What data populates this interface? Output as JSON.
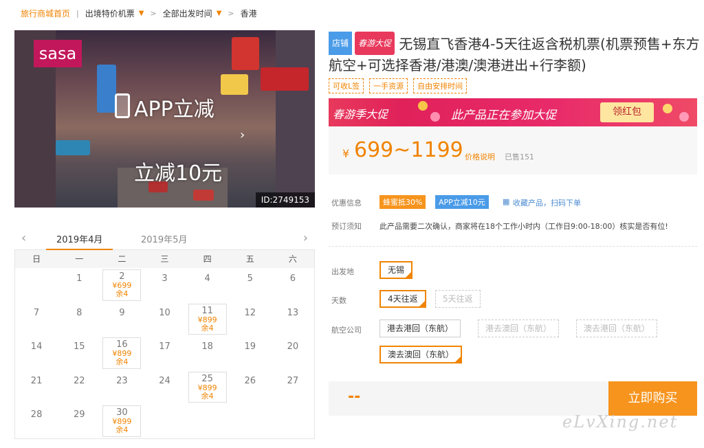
{
  "breadcrumb": {
    "home": "旅行商城首页",
    "level2": "出境特价机票",
    "level3": "全部出发时间",
    "current": "香港"
  },
  "hero": {
    "brand_sign": "sasa",
    "promo_line1": "APP立减",
    "promo_line2": "立减10元",
    "id_label": "ID:2749153",
    "slides": 4,
    "active_slide": 3
  },
  "calendar": {
    "tabs": [
      {
        "label": "2019年4月",
        "active": true
      },
      {
        "label": "2019年5月",
        "active": false
      }
    ],
    "weekdays": [
      "日",
      "一",
      "二",
      "三",
      "四",
      "五",
      "六"
    ],
    "days": [
      {
        "n": ""
      },
      {
        "n": "1"
      },
      {
        "n": "2",
        "price": "¥699",
        "left": "余4"
      },
      {
        "n": "3"
      },
      {
        "n": "4"
      },
      {
        "n": "5"
      },
      {
        "n": "6"
      },
      {
        "n": "7"
      },
      {
        "n": "8"
      },
      {
        "n": "9"
      },
      {
        "n": "10"
      },
      {
        "n": "11",
        "price": "¥899",
        "left": "余4"
      },
      {
        "n": "12"
      },
      {
        "n": "13"
      },
      {
        "n": "14"
      },
      {
        "n": "15"
      },
      {
        "n": "16",
        "price": "¥899",
        "left": "余4"
      },
      {
        "n": "17"
      },
      {
        "n": "18"
      },
      {
        "n": "19"
      },
      {
        "n": "20"
      },
      {
        "n": "21"
      },
      {
        "n": "22"
      },
      {
        "n": "23"
      },
      {
        "n": "24"
      },
      {
        "n": "25",
        "price": "¥899",
        "left": "余4"
      },
      {
        "n": "26"
      },
      {
        "n": "27"
      },
      {
        "n": "28"
      },
      {
        "n": "29"
      },
      {
        "n": "30",
        "price": "¥899",
        "left": "余4"
      },
      {
        "n": ""
      },
      {
        "n": ""
      },
      {
        "n": ""
      },
      {
        "n": ""
      }
    ]
  },
  "product": {
    "tag_shop": "店铺",
    "tag_spring": "春游大促",
    "title": "无锡直飞香港4-5天往返含税机票(机票预售+东方航空+可选择香港/港澳/澳港进出+行李额)",
    "chips": [
      "可收L签",
      "一手资源",
      "自由安排时间"
    ]
  },
  "banner": {
    "left_text": "春游季大促",
    "mid_text": "此产品正在参加大促",
    "button": "领红包"
  },
  "price": {
    "currency": "¥",
    "range": "699~1199",
    "note": "价格说明",
    "sold": "已售151"
  },
  "offers": {
    "label": "优惠信息",
    "coupon1": "蜂蜜抵30%",
    "coupon2": "APP立减10元",
    "collect": "收藏产品，扫码下单"
  },
  "booking": {
    "label": "预订须知",
    "text": "此产品需要二次确认，商家将在18个工作小时内（工作日9:00-18:00）核实是否有位!"
  },
  "options": {
    "departure_label": "出发地",
    "departure": "无锡",
    "days_label": "天数",
    "days": [
      "4天往返",
      "5天往返"
    ],
    "airline_label": "航空公司",
    "airlines": [
      "港去港回（东航）",
      "港去澳回（东航）",
      "澳去港回（东航）",
      "澳去澳回（东航）"
    ]
  },
  "footer": {
    "price_placeholder": "--",
    "buy_button": "立即购买",
    "watermark": "eLvXing.net"
  },
  "colors": {
    "accent": "#f08300",
    "buy": "#f7941d",
    "shop_tag": "#4a9be8",
    "promo_red": "#e8395c"
  }
}
